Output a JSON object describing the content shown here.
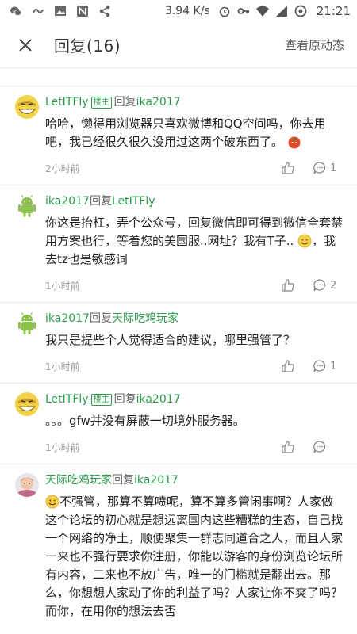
{
  "status_bar": {
    "net_speed": "3.94 K/s",
    "time": "21:21",
    "icons": [
      "wechat-icon",
      "link-icon",
      "image-icon",
      "n-app-icon",
      "share-icon",
      "alarm-icon",
      "key-icon",
      "wifi-icon",
      "sim-icon",
      "data-saver-icon"
    ]
  },
  "header": {
    "title": "回复(16)",
    "right_action": "查看原动态"
  },
  "comments": [
    {
      "avatar": "smiley-avatar",
      "user": "LetITFly",
      "badge": "楼主",
      "reply_word": "回复",
      "target": "ika2017",
      "text": "哈哈，懒得用浏览器只喜欢微博和QQ空间吗，你去用吧，我已经很久很久没用过这两个破东西了。",
      "emoji_after": "tomato-emoji",
      "time": "2小时前",
      "reply_count": "1"
    },
    {
      "avatar": "android-avatar",
      "user": "ika2017",
      "reply_word": "回复",
      "target": "LetITFly",
      "text": "你这是抬杠，弄个公众号，回复微信即可得到微信全套禁用方案也行，等着您的美国服..网址？我有T子..",
      "emoji_inline": "smile-emoji",
      "text_after": "，我去tz也是敏感词",
      "time": "1小时前",
      "reply_count": "2"
    },
    {
      "avatar": "android-avatar",
      "user": "ika2017",
      "reply_word": "回复",
      "target": "天际吃鸡玩家",
      "text": "我只是提些个人觉得适合的建议，哪里强管了？",
      "time": "1小时前",
      "reply_count": "1"
    },
    {
      "avatar": "smiley-avatar",
      "user": "LetITFly",
      "badge": "楼主",
      "reply_word": "回复",
      "target": "ika2017",
      "text": "。。。gfw并没有屏蔽一切境外服务器。",
      "time": "1小时前",
      "reply_count": ""
    },
    {
      "avatar": "child-photo-avatar",
      "user": "天际吃鸡玩家",
      "reply_word": "回复",
      "target": "ika2017",
      "emoji_before": "smile-emoji",
      "text": "不强管，那算不算喷呢，算不算多管闲事啊？人家做这个论坛的初心就是想远离国内这些糟糕的生态，自己找一个网络的净土，顺便聚集一群志同道合之人，而且人家一来也不强行要求你注册，你能以游客的身份浏览论坛所有内容，二来也不放广告，唯一的门槛就是翻出去。那么，你想想人家动了你的利益了吗？人家让你不爽了吗？而你，在用你的想法去否",
      "time": "",
      "reply_count": ""
    }
  ]
}
